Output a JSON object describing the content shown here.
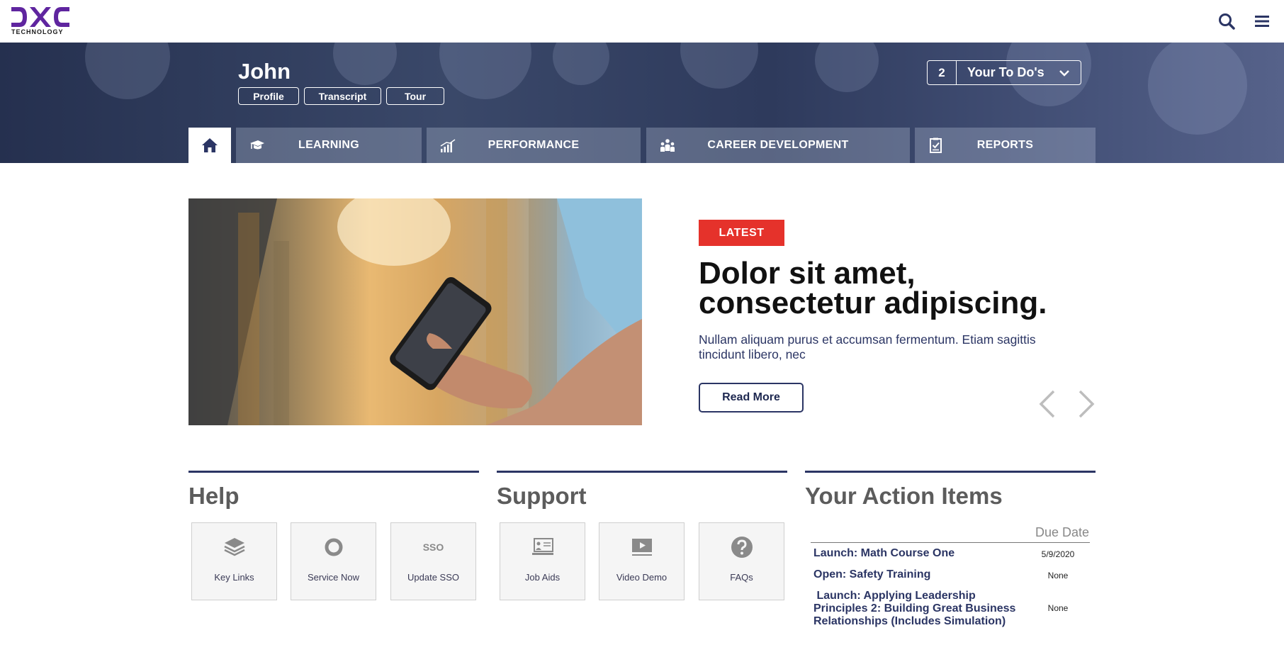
{
  "header": {
    "logo_word": "TECHNOLOGY",
    "logo_alt": "DXC",
    "icons": [
      "search-icon",
      "hamburger-menu-icon"
    ]
  },
  "hero": {
    "user_name": "John",
    "pills": [
      "Profile",
      "Transcript",
      "Tour"
    ],
    "todo": {
      "count": "2",
      "label": "Your To Do's"
    }
  },
  "tabs": [
    {
      "label": "",
      "icon": "home-icon"
    },
    {
      "label": "LEARNING",
      "icon": "graduation-cap-icon"
    },
    {
      "label": "PERFORMANCE",
      "icon": "bar-chart-icon"
    },
    {
      "label": "CAREER DEVELOPMENT",
      "icon": "people-icon"
    },
    {
      "label": "REPORTS",
      "icon": "clipboard-check-icon"
    }
  ],
  "feature": {
    "badge": "LATEST",
    "headline": "Dolor sit amet, consectetur adipiscing.",
    "body": "Nullam aliquam purus et accumsan fermentum. Etiam sagittis tincidunt libero, nec",
    "cta": "Read More",
    "image_desc": "hand holding smartphone in warehouse"
  },
  "help": {
    "title": "Help",
    "tiles": [
      {
        "label": "Key Links",
        "icon": "stack-layers-icon"
      },
      {
        "label": "Service Now",
        "icon": "ring-icon"
      },
      {
        "label": "Update SSO",
        "icon": "sso-text-icon",
        "icon_text": "SSO"
      }
    ]
  },
  "support": {
    "title": "Support",
    "tiles": [
      {
        "label": "Job Aids",
        "icon": "presentation-icon"
      },
      {
        "label": "Video Demo",
        "icon": "video-play-icon"
      },
      {
        "label": "FAQs",
        "icon": "question-circle-icon"
      }
    ]
  },
  "action_items": {
    "title": "Your Action Items",
    "due_header": "Due Date",
    "rows": [
      {
        "title": "Launch: Math Course One",
        "due": "5/9/2020"
      },
      {
        "title": "Open: Safety Training",
        "due": "None"
      },
      {
        "title": " Launch: Applying Leadership Principles 2: Building Great Business Relationships (Includes Simulation)",
        "due": "None"
      }
    ]
  },
  "colors": {
    "brand_purple": "#5f259f",
    "navy": "#2b3564",
    "badge_red": "#e5322b"
  }
}
